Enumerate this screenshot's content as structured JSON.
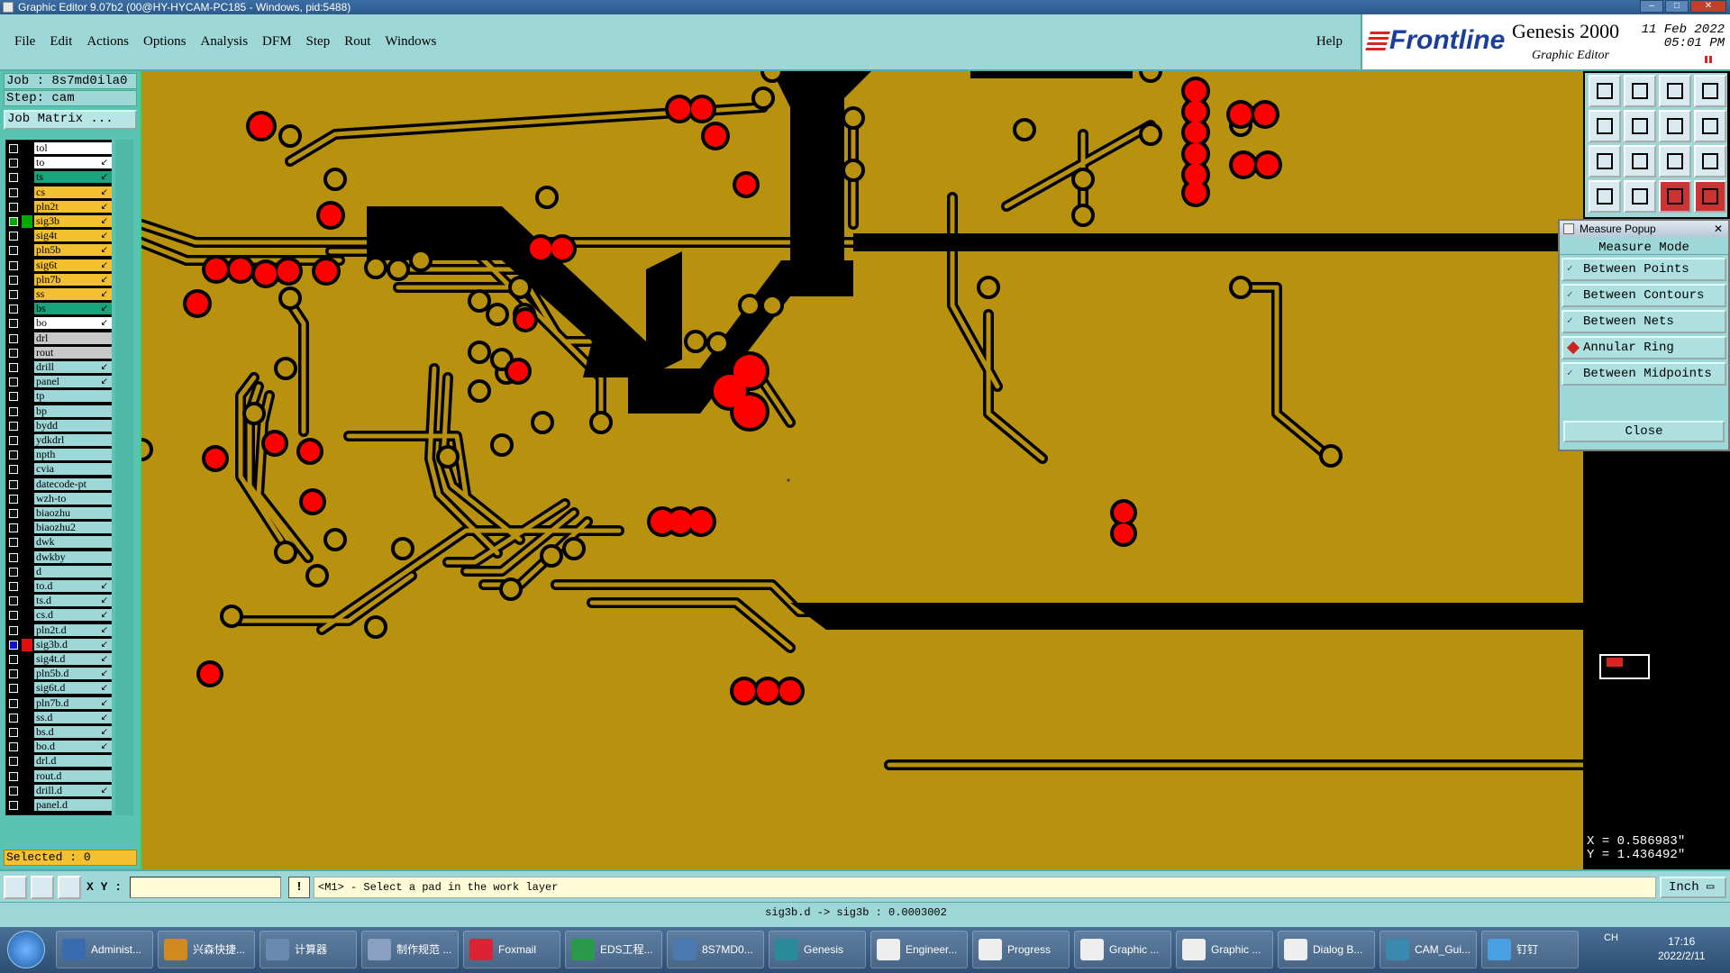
{
  "window": {
    "title": "Graphic Editor 9.07b2 (00@HY-HYCAM-PC185 - Windows, pid:5488)"
  },
  "menu": {
    "items": [
      "File",
      "Edit",
      "Actions",
      "Options",
      "Analysis",
      "DFM",
      "Step",
      "Rout",
      "Windows"
    ],
    "help": "Help"
  },
  "logo": {
    "brand": "Frontline",
    "product": "Genesis 2000",
    "subtitle": "Graphic Editor",
    "date": "11 Feb 2022",
    "time": "05:01 PM"
  },
  "job": {
    "job_label": "Job : 8s7md0ila0",
    "step_label": "Step: cam",
    "matrix_button": "Job Matrix ..."
  },
  "layers": [
    {
      "name": "tol",
      "color": "#ffffff",
      "arrow": ""
    },
    {
      "name": "to",
      "color": "#ffffff",
      "arrow": "↙"
    },
    {
      "name": "ts",
      "color": "#1aa37a",
      "arrow": "↙"
    },
    {
      "name": "cs",
      "color": "#f2c030",
      "arrow": "↙"
    },
    {
      "name": "pln2t",
      "color": "#f2c030",
      "arrow": "↙"
    },
    {
      "name": "sig3b",
      "color": "#f2c030",
      "arrow": "↙",
      "active": true
    },
    {
      "name": "sig4t",
      "color": "#f2c030",
      "arrow": "↙"
    },
    {
      "name": "pln5b",
      "color": "#f2c030",
      "arrow": "↙"
    },
    {
      "name": "sig6t",
      "color": "#f2c030",
      "arrow": "↙"
    },
    {
      "name": "pln7b",
      "color": "#f2c030",
      "arrow": "↙"
    },
    {
      "name": "ss",
      "color": "#f2c030",
      "arrow": "↙"
    },
    {
      "name": "bs",
      "color": "#1aa37a",
      "arrow": "↙"
    },
    {
      "name": "bo",
      "color": "#ffffff",
      "arrow": "↙"
    },
    {
      "name": "drl",
      "color": "#c8c8c8",
      "arrow": ""
    },
    {
      "name": "rout",
      "color": "#c8c8c8",
      "arrow": ""
    },
    {
      "name": "drill",
      "color": "#9ed7d7",
      "arrow": "↙"
    },
    {
      "name": "panel",
      "color": "#9ed7d7",
      "arrow": "↙"
    },
    {
      "name": "tp",
      "color": "#9ed7d7",
      "arrow": ""
    },
    {
      "name": "bp",
      "color": "#9ed7d7",
      "arrow": ""
    },
    {
      "name": "bydd",
      "color": "#9ed7d7",
      "arrow": ""
    },
    {
      "name": "ydkdrl",
      "color": "#9ed7d7",
      "arrow": ""
    },
    {
      "name": "npth",
      "color": "#9ed7d7",
      "arrow": ""
    },
    {
      "name": "cvia",
      "color": "#9ed7d7",
      "arrow": ""
    },
    {
      "name": "datecode-pt",
      "color": "#9ed7d7",
      "arrow": ""
    },
    {
      "name": "wzh-to",
      "color": "#9ed7d7",
      "arrow": ""
    },
    {
      "name": "biaozhu",
      "color": "#9ed7d7",
      "arrow": ""
    },
    {
      "name": "biaozhu2",
      "color": "#9ed7d7",
      "arrow": ""
    },
    {
      "name": "dwk",
      "color": "#9ed7d7",
      "arrow": ""
    },
    {
      "name": "dwkby",
      "color": "#9ed7d7",
      "arrow": ""
    },
    {
      "name": "d",
      "color": "#9ed7d7",
      "arrow": ""
    },
    {
      "name": "to.d",
      "color": "#9ed7d7",
      "arrow": "↙"
    },
    {
      "name": "ts.d",
      "color": "#9ed7d7",
      "arrow": "↙"
    },
    {
      "name": "cs.d",
      "color": "#9ed7d7",
      "arrow": "↙"
    },
    {
      "name": "pln2t.d",
      "color": "#9ed7d7",
      "arrow": "↙"
    },
    {
      "name": "sig3b.d",
      "color": "#9ed7d7",
      "arrow": "↙",
      "work": true
    },
    {
      "name": "sig4t.d",
      "color": "#9ed7d7",
      "arrow": "↙"
    },
    {
      "name": "pln5b.d",
      "color": "#9ed7d7",
      "arrow": "↙"
    },
    {
      "name": "sig6t.d",
      "color": "#9ed7d7",
      "arrow": "↙"
    },
    {
      "name": "pln7b.d",
      "color": "#9ed7d7",
      "arrow": "↙"
    },
    {
      "name": "ss.d",
      "color": "#9ed7d7",
      "arrow": "↙"
    },
    {
      "name": "bs.d",
      "color": "#9ed7d7",
      "arrow": "↙"
    },
    {
      "name": "bo.d",
      "color": "#9ed7d7",
      "arrow": "↙"
    },
    {
      "name": "drl.d",
      "color": "#9ed7d7",
      "arrow": ""
    },
    {
      "name": "rout.d",
      "color": "#9ed7d7",
      "arrow": ""
    },
    {
      "name": "drill.d",
      "color": "#9ed7d7",
      "arrow": "↙"
    },
    {
      "name": "panel.d",
      "color": "#9ed7d7",
      "arrow": ""
    }
  ],
  "selected": "Selected : 0",
  "measure": {
    "title": "Measure Popup",
    "mode_label": "Measure Mode",
    "options": [
      {
        "label": "Between Points",
        "selected": false
      },
      {
        "label": "Between Contours",
        "selected": false
      },
      {
        "label": "Between Nets",
        "selected": false
      },
      {
        "label": "Annular Ring",
        "selected": true
      },
      {
        "label": "Between Midpoints",
        "selected": false
      }
    ],
    "close": "Close"
  },
  "coords": {
    "x": "X = 0.586983\"",
    "y": "Y = 1.436492\""
  },
  "prompt": {
    "xy_label": "X Y :",
    "xy_value": "",
    "excl": "!",
    "message": "<M1> - Select a pad in the work layer",
    "units": "Inch"
  },
  "status": "sig3b.d -> sig3b : 0.0003002",
  "taskbar": {
    "items": [
      "Administ...",
      "兴森快捷...",
      "计算器",
      "制作规范 ...",
      "Foxmail",
      "EDS工程...",
      "8S7MD0...",
      "Genesis",
      "Engineer...",
      "Progress",
      "Graphic ...",
      "Graphic ...",
      "Dialog B...",
      "CAM_Gui...",
      "钉钉"
    ],
    "tray": "CH",
    "time": "17:16",
    "date": "2022/2/11"
  },
  "colors": {
    "board": "#b8920e",
    "copper": "#000000",
    "pad": "#ff0000",
    "panel_bg": "#9ed7d7"
  }
}
